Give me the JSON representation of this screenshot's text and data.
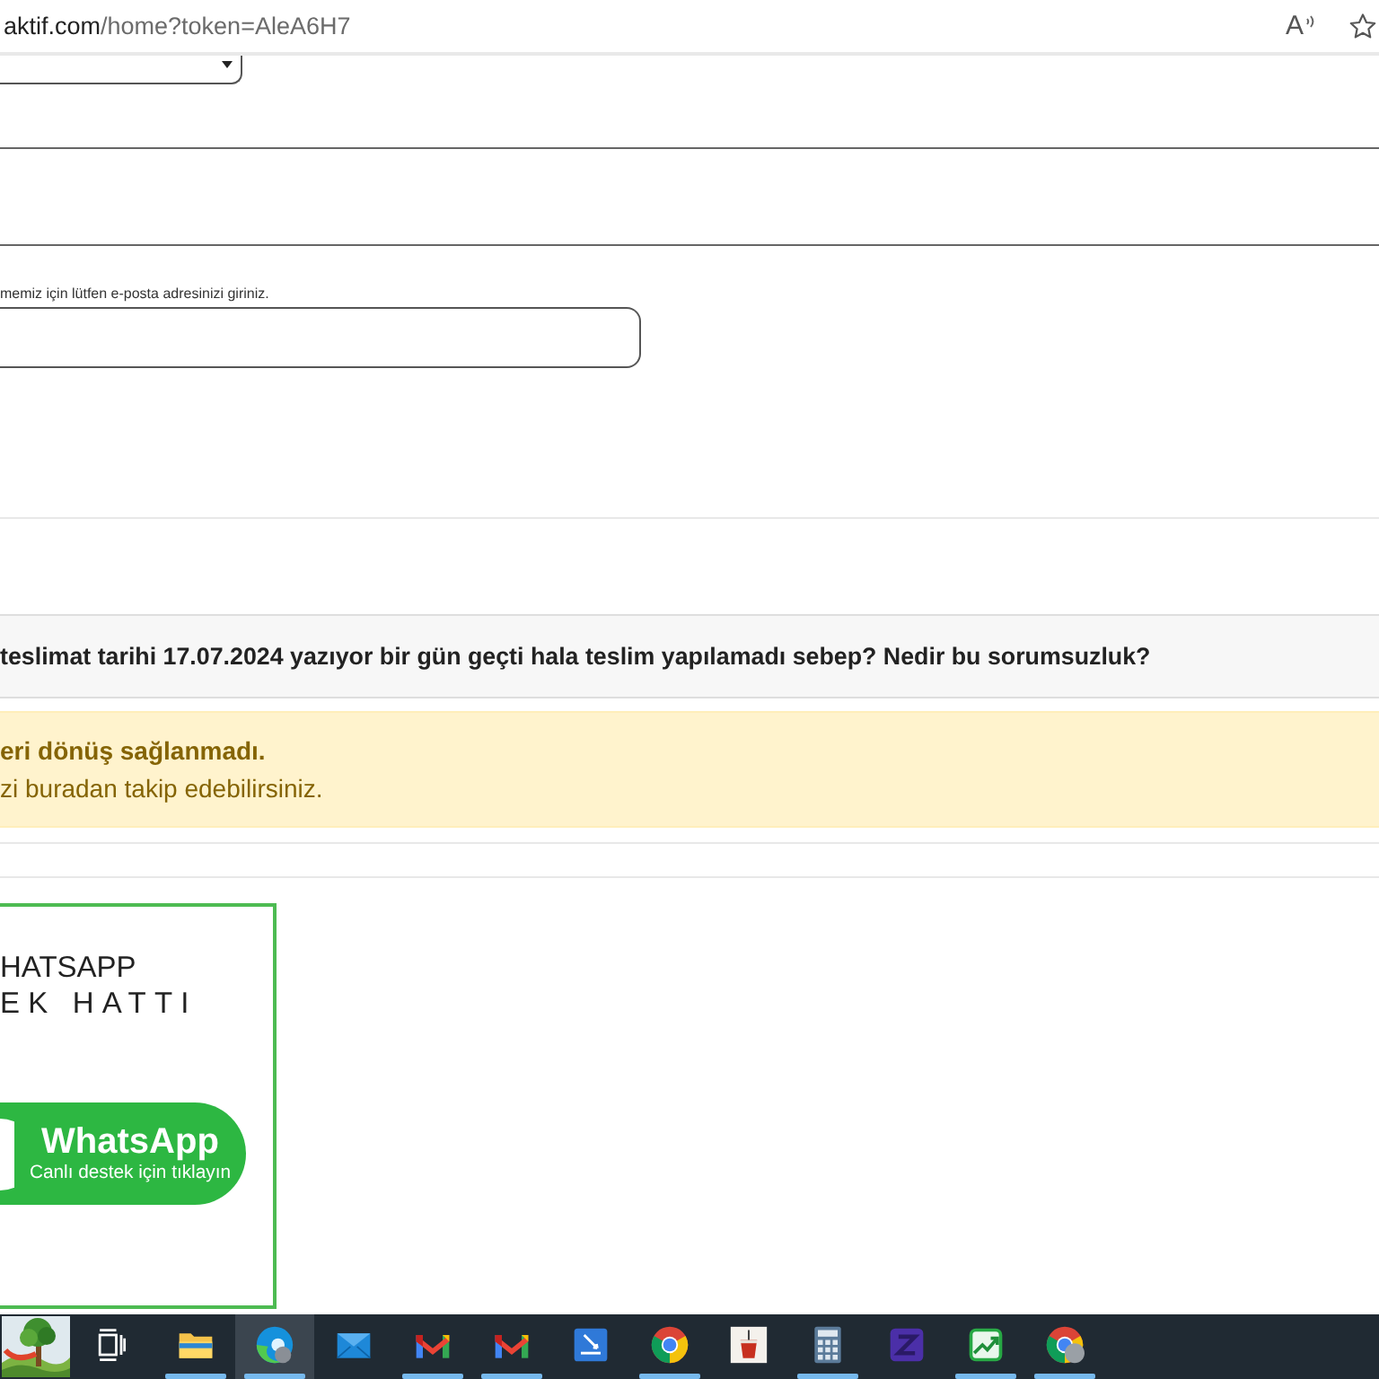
{
  "address_bar": {
    "host": "aktif.com",
    "path": "/home?token=AleA6H7",
    "actions": [
      {
        "kind": "read_aloud",
        "glyph": "A"
      },
      {
        "kind": "favorite"
      }
    ]
  },
  "form": {
    "email_hint": "memiz için lütfen e-posta adresinizi giriniz."
  },
  "message": {
    "text": "teslimat tarihi 17.07.2024 yazıyor bir gün geçti hala teslim yapılamadı sebep? Nedir bu sorumsuzluk?"
  },
  "alert": {
    "title": "eri dönüş sağlanmadı.",
    "text": "zi buradan takip edebilirsiniz."
  },
  "support_card": {
    "heading_lines": [
      "HATSAPP",
      "EK HATTI"
    ],
    "button": {
      "title": "WhatsApp",
      "subtitle": "Canlı destek için tıklayın"
    }
  },
  "taskbar": {
    "items": [
      {
        "kind": "landscape",
        "running": false,
        "selected": false
      },
      {
        "kind": "task_view",
        "running": false,
        "selected": false
      },
      {
        "kind": "folder",
        "running": true,
        "selected": false
      },
      {
        "kind": "swirl_browser",
        "running": true,
        "selected": true
      },
      {
        "kind": "envelope",
        "running": false,
        "selected": false
      },
      {
        "kind": "m_logo",
        "running": true,
        "selected": false
      },
      {
        "kind": "m_logo",
        "running": true,
        "selected": false
      },
      {
        "kind": "document",
        "running": false,
        "selected": false
      },
      {
        "kind": "ring_browser",
        "running": true,
        "selected": false
      },
      {
        "kind": "cup",
        "running": false,
        "selected": false
      },
      {
        "kind": "calculator",
        "running": true,
        "selected": false
      },
      {
        "kind": "zigzag",
        "running": false,
        "selected": false
      },
      {
        "kind": "chart",
        "running": true,
        "selected": false
      },
      {
        "kind": "ring_browser_profile",
        "running": true,
        "selected": false
      }
    ]
  }
}
